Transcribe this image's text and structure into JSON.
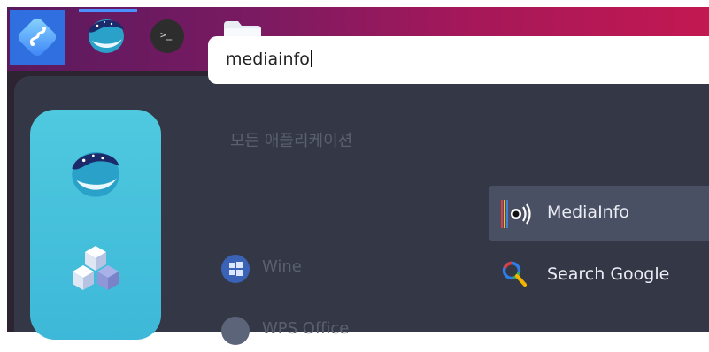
{
  "taskbar": {
    "start_icon": "deepin-launcher-icon",
    "apps": [
      {
        "name": "Naver Whale",
        "icon": "whale-browser-icon",
        "active": true
      },
      {
        "name": "Terminal",
        "icon": "terminal-icon",
        "prompt": ">_"
      },
      {
        "name": "Files",
        "icon": "folder-icon"
      }
    ],
    "gradient": [
      "#5a1a5e",
      "#c31851"
    ]
  },
  "launcher": {
    "search": {
      "value": "mediainfo"
    },
    "sidebar": [
      {
        "icon": "whale-browser-icon"
      },
      {
        "icon": "cubes-icon"
      }
    ],
    "category_header": "모든 애플리케이션",
    "categories": [
      {
        "label": "Wine",
        "icon": "windows-icon"
      },
      {
        "label": "WPS Office",
        "icon": "wps-icon"
      }
    ],
    "results": [
      {
        "label": "MediaInfo",
        "icon": "mediainfo-icon",
        "selected": true
      },
      {
        "label": "Search Google",
        "icon": "search-icon",
        "selected": false
      }
    ]
  },
  "colors": {
    "accent": "#2f6fe0",
    "panel": "#343846",
    "rail": "#4fc9df",
    "selected_row": "#4a5064"
  }
}
